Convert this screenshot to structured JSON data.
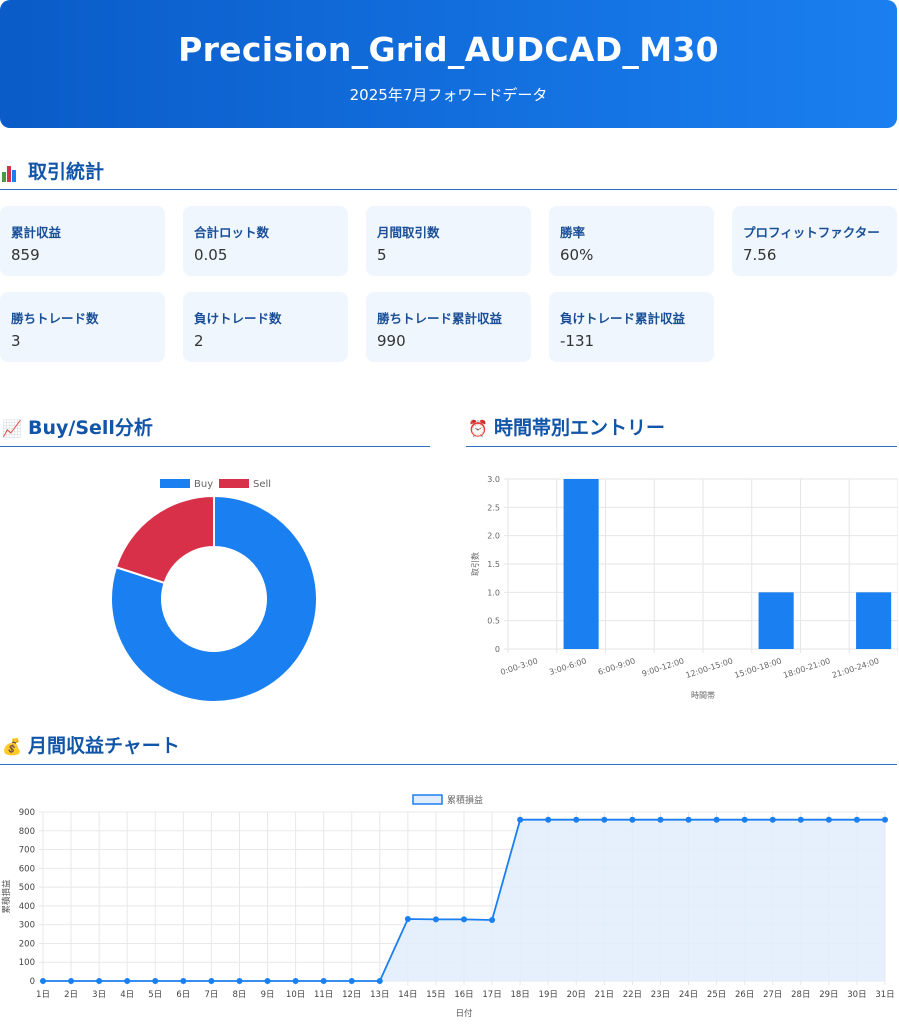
{
  "header": {
    "title": "Precision_Grid_AUDCAD_M30",
    "subtitle": "2025年7月フォワードデータ"
  },
  "sections": {
    "stats": "取引統計",
    "buysell": "Buy/Sell分析",
    "hourly": "時間帯別エントリー",
    "monthly": "月間収益チャート"
  },
  "stats": [
    {
      "label": "累計収益",
      "value": "859"
    },
    {
      "label": "合計ロット数",
      "value": "0.05"
    },
    {
      "label": "月間取引数",
      "value": "5"
    },
    {
      "label": "勝率",
      "value": "60%"
    },
    {
      "label": "プロフィットファクター",
      "value": "7.56"
    },
    {
      "label": "勝ちトレード数",
      "value": "3"
    },
    {
      "label": "負けトレード数",
      "value": "2"
    },
    {
      "label": "勝ちトレード累計収益",
      "value": "990"
    },
    {
      "label": "負けトレード累計収益",
      "value": "-131"
    }
  ],
  "colors": {
    "buy": "#1a7ff0",
    "sell": "#d9304a",
    "bar": "#1a7ff0",
    "line": "#1a7ff0",
    "fill": "#e0edfc"
  },
  "chart_data": [
    {
      "type": "pie",
      "legend": [
        "Buy",
        "Sell"
      ],
      "labels": [
        "Buy",
        "Sell"
      ],
      "values": [
        4,
        1
      ],
      "legend_position": "top"
    },
    {
      "type": "bar",
      "categories": [
        "0:00-3:00",
        "3:00-6:00",
        "6:00-9:00",
        "9:00-12:00",
        "12:00-15:00",
        "15:00-18:00",
        "18:00-21:00",
        "21:00-24:00"
      ],
      "values": [
        0,
        3,
        0,
        0,
        0,
        1,
        0,
        1
      ],
      "xlabel": "時間帯",
      "ylabel": "取引数",
      "ylim": [
        0,
        3.0
      ],
      "yticks": [
        "0",
        "0.5",
        "1.0",
        "1.5",
        "2.0",
        "2.5",
        "3.0"
      ],
      "grid": true
    },
    {
      "type": "area",
      "series": [
        {
          "name": "累積損益",
          "values": [
            0,
            0,
            0,
            0,
            0,
            0,
            0,
            0,
            0,
            0,
            0,
            0,
            0,
            330,
            328,
            328,
            325,
            859,
            859,
            859,
            859,
            859,
            859,
            859,
            859,
            859,
            859,
            859,
            859,
            859,
            859
          ]
        }
      ],
      "categories": [
        "1日",
        "2日",
        "3日",
        "4日",
        "5日",
        "6日",
        "7日",
        "8日",
        "9日",
        "10日",
        "11日",
        "12日",
        "13日",
        "14日",
        "15日",
        "16日",
        "17日",
        "18日",
        "19日",
        "20日",
        "21日",
        "22日",
        "23日",
        "24日",
        "25日",
        "26日",
        "27日",
        "28日",
        "29日",
        "30日",
        "31日"
      ],
      "xlabel": "日付",
      "ylabel": "累積損益",
      "ylim": [
        0,
        900
      ],
      "yticks": [
        "0",
        "100",
        "200",
        "300",
        "400",
        "500",
        "600",
        "700",
        "800",
        "900"
      ],
      "grid": true,
      "legend_position": "top"
    }
  ]
}
